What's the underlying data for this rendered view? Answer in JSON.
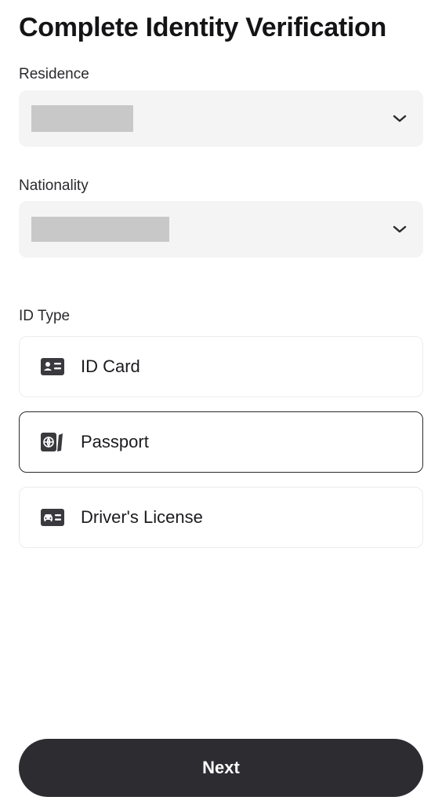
{
  "page": {
    "title": "Complete Identity Verification"
  },
  "residence": {
    "label": "Residence",
    "value": ""
  },
  "nationality": {
    "label": "Nationality",
    "value": ""
  },
  "id_type": {
    "label": "ID Type",
    "options": [
      {
        "label": "ID Card",
        "icon": "id-card-icon",
        "selected": false
      },
      {
        "label": "Passport",
        "icon": "passport-icon",
        "selected": true
      },
      {
        "label": "Driver's License",
        "icon": "drivers-license-icon",
        "selected": false
      }
    ]
  },
  "actions": {
    "next_label": "Next"
  },
  "colors": {
    "primary": "#2d2d31",
    "field_background": "#f4f4f4",
    "redacted": "#c8c8c8"
  }
}
